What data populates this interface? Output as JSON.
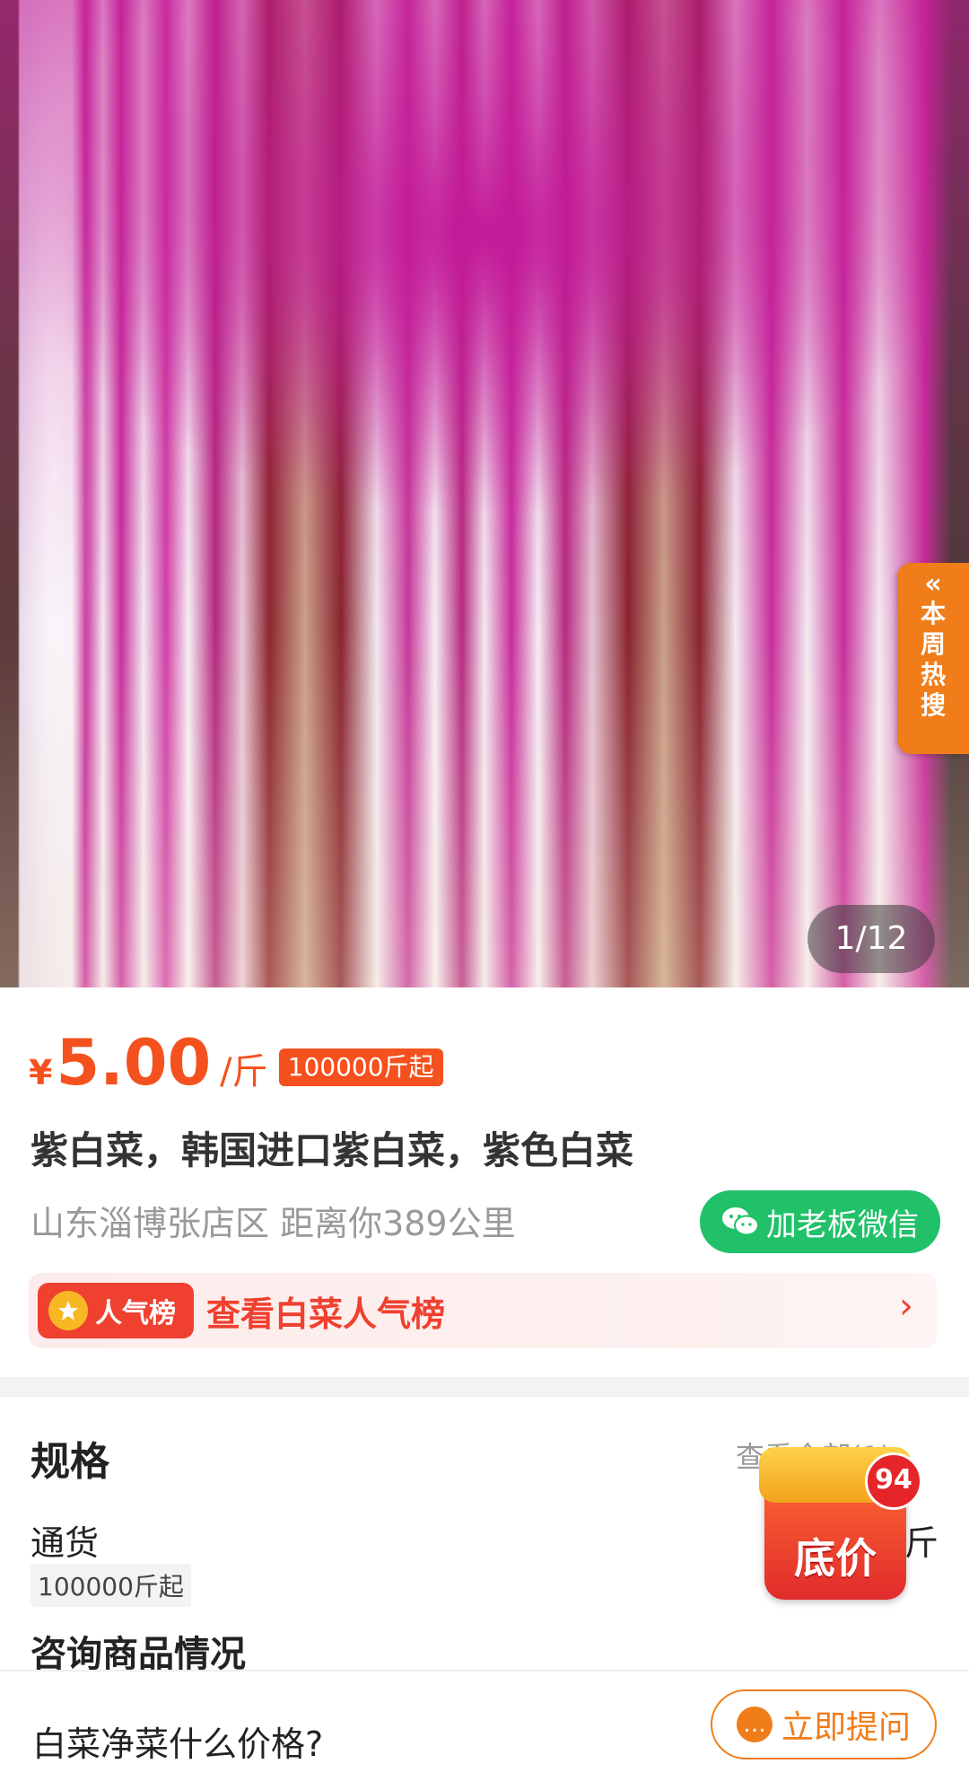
{
  "hero": {
    "image_alt": "purple napa cabbage cut in half",
    "counter": "1/12",
    "hot_tab": {
      "arrows": "«",
      "label": "本周热搜"
    }
  },
  "product": {
    "currency": "¥",
    "price": "5.00",
    "unit": "/斤",
    "min_order": "100000斤起",
    "title": "紫白菜，韩国进口紫白菜，紫色白菜",
    "location": "山东淄博张店区 距离你389公里",
    "wechat_button": "加老板微信"
  },
  "ranking": {
    "badge": "人气榜",
    "text": "查看白菜人气榜",
    "arrow": "›"
  },
  "spec": {
    "title": "规格",
    "view_all": "查看全部(1)",
    "view_all_arrow": "›",
    "item_name": "通货",
    "item_min": "100000斤起",
    "item_unit": "斤"
  },
  "promo": {
    "label": "底价",
    "count": "94"
  },
  "consult": {
    "title": "咨询商品情况",
    "question": "白菜净菜什么价格?",
    "ask_button": "立即提问"
  },
  "colors": {
    "accent": "#f4511e",
    "orange": "#f07d1a",
    "wechat_green": "#21c16a",
    "rank_red": "#ef4030"
  }
}
